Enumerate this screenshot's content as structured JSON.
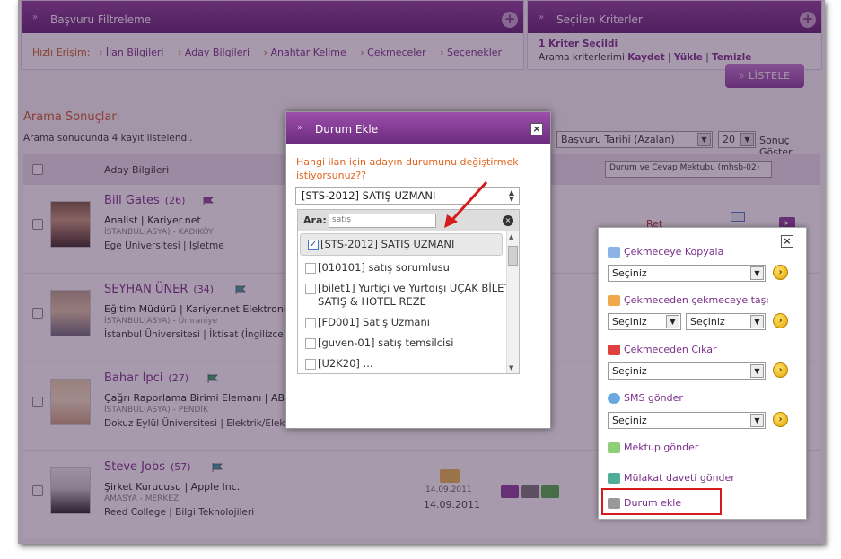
{
  "filter_panel": {
    "title": "Başvuru Filtreleme"
  },
  "quick_access": {
    "label": "Hızlı Erişim:",
    "links": [
      "İlan Bilgileri",
      "Aday Bilgileri",
      "Anahtar Kelime",
      "Çekmeceler",
      "Seçenekler"
    ]
  },
  "criteria_panel": {
    "title": "Seçilen Kriterler",
    "selected": "1 Kriter Seçildi",
    "prefix": "Arama kriterlerimi",
    "save": "Kaydet",
    "load": "Yükle",
    "clear": "Temizle"
  },
  "list_button": "LİSTELE",
  "results": {
    "title": "Arama Sonuçları",
    "count_text": "Arama sonucunda 4 kayıt listelendi.",
    "sort_value": "Başvuru Tarihi (Azalan)",
    "per_page": "20",
    "per_page_suffix": "Sonuç Göster"
  },
  "table": {
    "col_candidate": "Aday Bilgileri",
    "col_status_select": "Durum ve Cevap Mektubu (mhsb-02)"
  },
  "candidates": [
    {
      "name": "Bill Gates",
      "age": "(26)",
      "title": "Analist | Kariyer.net",
      "location": "İSTANBUL(ASYA) - KADIKÖY",
      "education": "Ege Üniversitesi | İşletme",
      "status": "Ret",
      "date": ""
    },
    {
      "name": "SEYHAN ÜNER",
      "age": "(34)",
      "title": "Eğitim Müdürü | Kariyer.net Elektronik",
      "location": "İSTANBUL(ASYA) - Ümraniye",
      "education": "İstanbul Üniversitesi | İktisat (İngilizce)",
      "status": "",
      "date": ""
    },
    {
      "name": "Bahar İpci",
      "age": "(27)",
      "title": "Çağrı Raporlama Birimi Elemanı | ABC I",
      "location": "İSTANBUL(ASYA) - PENDİK",
      "education": "Dokuz Eylül Üniversitesi | Elektrik/Elekt",
      "status": "",
      "date": ""
    },
    {
      "name": "Steve Jobs",
      "age": "(57)",
      "title": "Şirket Kurucusu | Apple Inc.",
      "location": "AMASYA - MERKEZ",
      "education": "Reed College | Bilgi Teknolojileri",
      "status": "",
      "date": "14.09.2011"
    }
  ],
  "modal": {
    "title": "Durum Ekle",
    "question": "Hangi ilan için adayın durumunu değiştirmek istiyorsunuz??",
    "selected": "[STS-2012]  SATIŞ UZMANI",
    "search_label": "Ara:",
    "search_value": "satış",
    "options": [
      "[STS-2012]  SATIŞ UZMANI",
      "[010101]  satış sorumlusu",
      "[bilet1]  Yurtiçi ve Yurtdışı UÇAK BİLETİ SATIŞ & HOTEL REZE",
      "[FD001]  Satış Uzmanı",
      "[guven-01]  satış temsilcisi",
      "[U2K20]  ..."
    ]
  },
  "actions": {
    "copy_to_drawer": "Çekmeceye Kopyala",
    "move_drawer": "Çekmeceden çekmeceye taşı",
    "remove_from_drawer": "Çekmeceden Çıkar",
    "send_sms": "SMS gönder",
    "send_letter": "Mektup gönder",
    "send_interview": "Mülakat daveti gönder",
    "add_status": "Durum ekle",
    "select_placeholder": "Seçiniz"
  }
}
